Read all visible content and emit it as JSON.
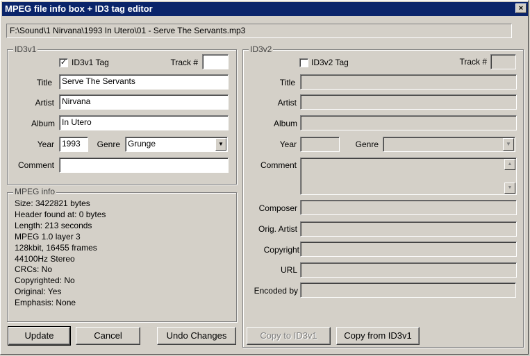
{
  "window": {
    "title": "MPEG file info box + ID3 tag editor",
    "close_glyph": "×"
  },
  "file_path": "F:\\Sound\\1 Nirvana\\1993 In Utero\\01 - Serve The Servants.mp3",
  "id3v1": {
    "group_label": "ID3v1",
    "tag_checkbox_label": "ID3v1 Tag",
    "tag_checked": true,
    "check_glyph": "✓",
    "track_label": "Track #",
    "track_value": "",
    "title_label": "Title",
    "title_value": "Serve The Servants",
    "artist_label": "Artist",
    "artist_value": "Nirvana",
    "album_label": "Album",
    "album_value": "In Utero",
    "year_label": "Year",
    "year_value": "1993",
    "genre_label": "Genre",
    "genre_value": "Grunge",
    "comment_label": "Comment",
    "comment_value": ""
  },
  "mpeg_info": {
    "group_label": "MPEG info",
    "lines": [
      "Size: 3422821 bytes",
      "Header found at: 0 bytes",
      "Length: 213 seconds",
      "MPEG 1.0 layer 3",
      "128kbit, 16455 frames",
      "44100Hz Stereo",
      "CRCs: No",
      "Copyrighted: No",
      "Original: Yes",
      "Emphasis: None"
    ]
  },
  "id3v2": {
    "group_label": "ID3v2",
    "tag_checkbox_label": "ID3v2 Tag",
    "tag_checked": false,
    "track_label": "Track #",
    "title_label": "Title",
    "artist_label": "Artist",
    "album_label": "Album",
    "year_label": "Year",
    "genre_label": "Genre",
    "comment_label": "Comment",
    "composer_label": "Composer",
    "orig_artist_label": "Orig. Artist",
    "copyright_label": "Copyright",
    "url_label": "URL",
    "encoded_by_label": "Encoded by"
  },
  "buttons": {
    "update": "Update",
    "cancel": "Cancel",
    "undo": "Undo Changes",
    "copy_to_v1": "Copy to ID3v1",
    "copy_from_v1": "Copy from ID3v1"
  },
  "icons": {
    "dropdown_arrow": "▼",
    "scroll_up": "▲",
    "scroll_down": "▼"
  }
}
